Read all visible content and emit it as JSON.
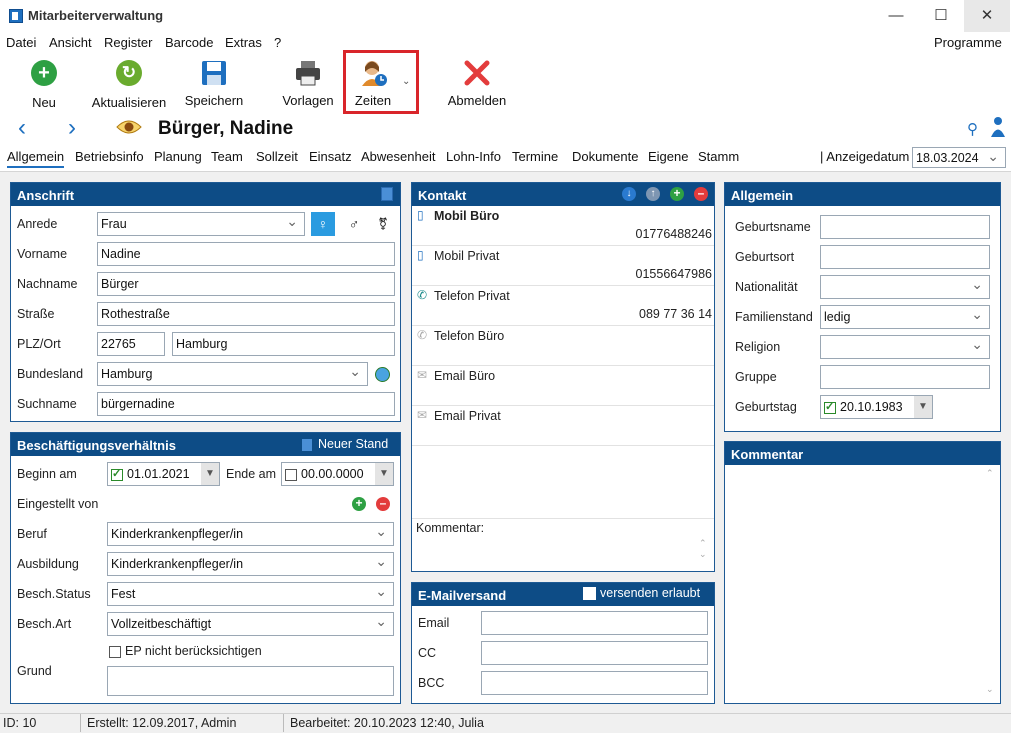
{
  "window": {
    "title": "Mitarbeiterverwaltung"
  },
  "menu": {
    "items": [
      "Datei",
      "Ansicht",
      "Register",
      "Barcode",
      "Extras",
      "?"
    ],
    "programme": "Programme"
  },
  "toolbar": {
    "neu": "Neu",
    "aktualisieren": "Aktualisieren",
    "speichern": "Speichern",
    "vorlagen": "Vorlagen",
    "zeiten": "Zeiten",
    "abmelden": "Abmelden"
  },
  "header": {
    "name": "Bürger, Nadine"
  },
  "tabs": [
    "Allgemein",
    "Betriebsinfo",
    "Planung",
    "Team",
    "Sollzeit",
    "Einsatz",
    "Abwesenheit",
    "Lohn-Info",
    "Termine",
    "Dokumente",
    "Eigene",
    "Stamm"
  ],
  "anzeigedatum": {
    "label": "Anzeigedatum",
    "value": "18.03.2024"
  },
  "anschrift": {
    "title": "Anschrift",
    "anrede_label": "Anrede",
    "anrede": "Frau",
    "vorname_label": "Vorname",
    "vorname": "Nadine",
    "nachname_label": "Nachname",
    "nachname": "Bürger",
    "strasse_label": "Straße",
    "strasse": "Rothestraße",
    "plz_label": "PLZ/Ort",
    "plz": "22765",
    "ort": "Hamburg",
    "bundesland_label": "Bundesland",
    "bundesland": "Hamburg",
    "suchname_label": "Suchname",
    "suchname": "bürgernadine"
  },
  "besch": {
    "title": "Beschäftigungsverhältnis",
    "neuer_stand": "Neuer Stand",
    "beginn_label": "Beginn am",
    "beginn": "01.01.2021",
    "ende_label": "Ende am",
    "ende": "00.00.0000",
    "eingestellt_label": "Eingestellt von",
    "beruf_label": "Beruf",
    "beruf": "Kinderkrankenpfleger/in",
    "ausbildung_label": "Ausbildung",
    "ausbildung": "Kinderkrankenpfleger/in",
    "status_label": "Besch.Status",
    "status": "Fest",
    "art_label": "Besch.Art",
    "art": "Vollzeitbeschäftigt",
    "ep_label": "EP nicht berücksichtigen",
    "grund_label": "Grund"
  },
  "kontakt": {
    "title": "Kontakt",
    "items": [
      {
        "name": "Mobil Büro",
        "value": "01776488246"
      },
      {
        "name": "Mobil Privat",
        "value": "01556647986"
      },
      {
        "name": "Telefon Privat",
        "value": "089 77 36 14"
      },
      {
        "name": "Telefon Büro",
        "value": ""
      },
      {
        "name": "Email Büro",
        "value": ""
      },
      {
        "name": "Email Privat",
        "value": ""
      }
    ],
    "kommentar_label": "Kommentar:"
  },
  "email": {
    "title": "E-Mailversand",
    "versenden": "versenden erlaubt",
    "email_label": "Email",
    "cc_label": "CC",
    "bcc_label": "BCC"
  },
  "allgemein": {
    "title": "Allgemein",
    "geburtsname_label": "Geburtsname",
    "geburtsort_label": "Geburtsort",
    "nationalitaet_label": "Nationalität",
    "familienstand_label": "Familienstand",
    "familienstand": "ledig",
    "religion_label": "Religion",
    "gruppe_label": "Gruppe",
    "geburtstag_label": "Geburtstag",
    "geburtstag": "20.10.1983"
  },
  "kommentar": {
    "title": "Kommentar"
  },
  "status": {
    "id": "ID: 10",
    "erstellt": "Erstellt: 12.09.2017, Admin",
    "bearbeitet": "Bearbeitet: 20.10.2023 12:40, Julia"
  },
  "colors": {
    "header_blue": "#0d4c86",
    "highlight_red": "#d9252a"
  }
}
